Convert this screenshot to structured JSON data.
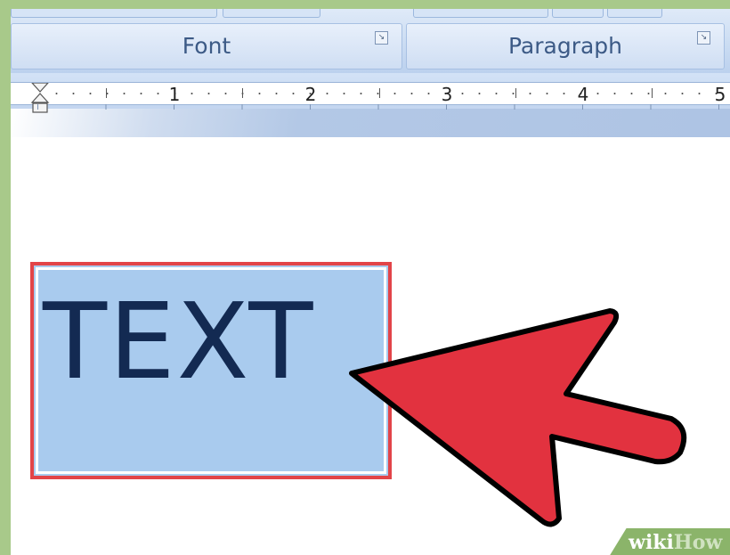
{
  "ribbon": {
    "groups": [
      {
        "label": "Font",
        "launcher_icon": "dialog-launcher-icon"
      },
      {
        "label": "Paragraph",
        "launcher_icon": "dialog-launcher-icon"
      }
    ],
    "launcher_glyph": "↘"
  },
  "ruler": {
    "numbers": [
      "1",
      "2",
      "3",
      "4",
      "5"
    ]
  },
  "document": {
    "text_box_content": "TEXT"
  },
  "annotation": {
    "arrow_color": "#e2323f",
    "highlight_color": "#e24448"
  },
  "watermark": {
    "part1": "wiki",
    "part2": "How"
  }
}
